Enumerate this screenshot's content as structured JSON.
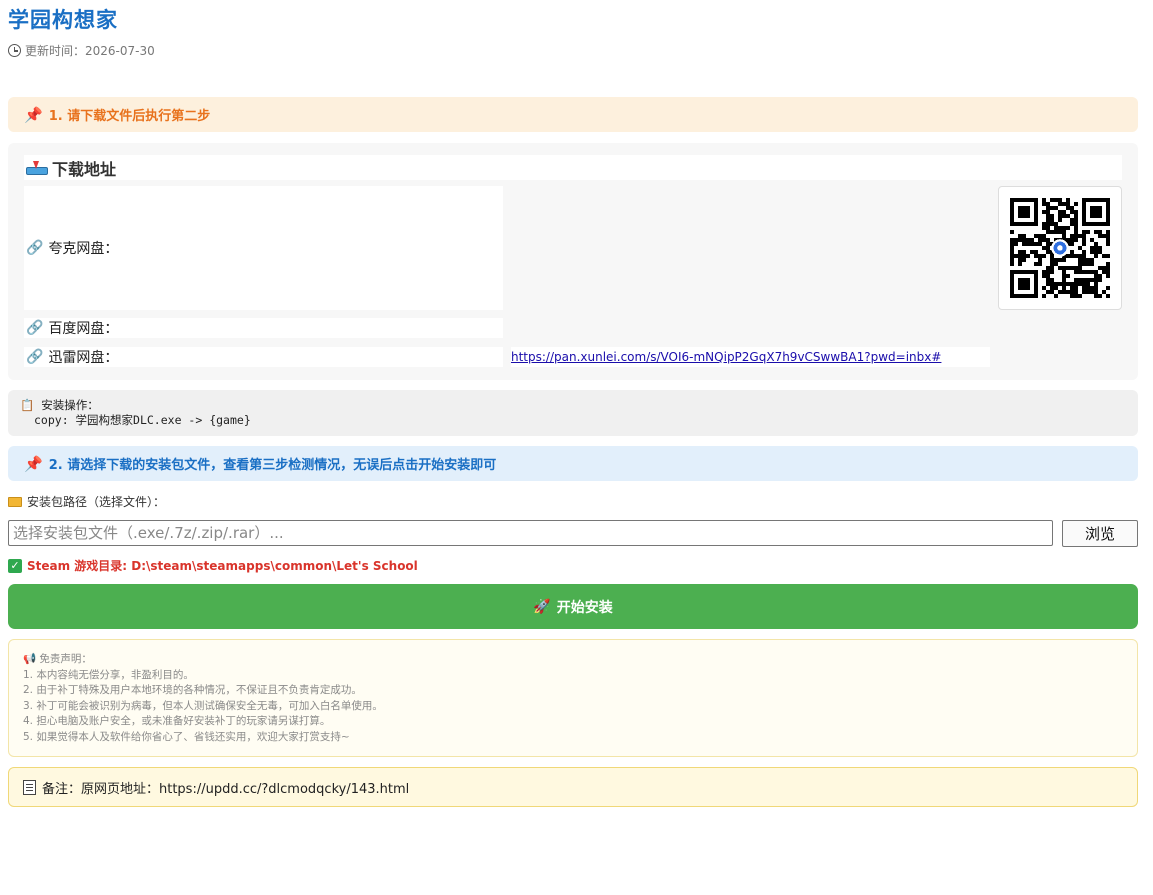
{
  "header": {
    "title": "学园构想家",
    "updated_label": "更新时间：2026-07-30"
  },
  "step1": {
    "icon": "pushpin-icon",
    "text": "1. 请下载文件后执行第二步"
  },
  "download": {
    "heading": "下载地址",
    "quark_label": "夸克网盘：",
    "baidu_label": "百度网盘：",
    "xunlei_label": "迅雷网盘：",
    "xunlei_url": "https://pan.xunlei.com/s/VOI6-mNQipP2GqX7h9vCSwwBA1?pwd=inbx#",
    "link_icon": "link-icon"
  },
  "install_op": {
    "title": "安装操作：",
    "command": "copy: 学园构想家DLC.exe -> {game}"
  },
  "step2": {
    "icon": "pushpin-icon",
    "text": "2. 请选择下载的安装包文件，查看第三步检测情况，无误后点击开始安装即可"
  },
  "installer": {
    "path_label": "安装包路径（选择文件）：",
    "path_placeholder": "选择安装包文件（.exe/.7z/.zip/.rar）...",
    "path_value": "",
    "browse_label": "浏览",
    "steam_dir": "Steam 游戏目录: D:\\steam\\steamapps\\common\\Let's School",
    "start_label": "开始安装"
  },
  "disclaimer": {
    "title": "免责声明：",
    "items": [
      "1. 本内容纯无偿分享，非盈利目的。",
      "2. 由于补丁特殊及用户本地环境的各种情况，不保证且不负责肯定成功。",
      "3. 补丁可能会被识别为病毒，但本人测试确保安全无毒，可加入白名单使用。",
      "4. 担心电脑及账户安全，或未准备好安装补丁的玩家请另谋打算。",
      "5. 如果觉得本人及软件给你省心了、省钱还实用，欢迎大家打赏支持~"
    ]
  },
  "note": {
    "text": "备注：原网页地址：https://updd.cc/?dlcmodqcky/143.html"
  },
  "colors": {
    "title": "#1a6fc4",
    "step1_bg": "#fdf0dd",
    "step1_text": "#e8721d",
    "step2_bg": "#e2effb",
    "step2_text": "#1a6fc4",
    "start_button": "#4caf50",
    "steam_dir_text": "#d9342b"
  }
}
